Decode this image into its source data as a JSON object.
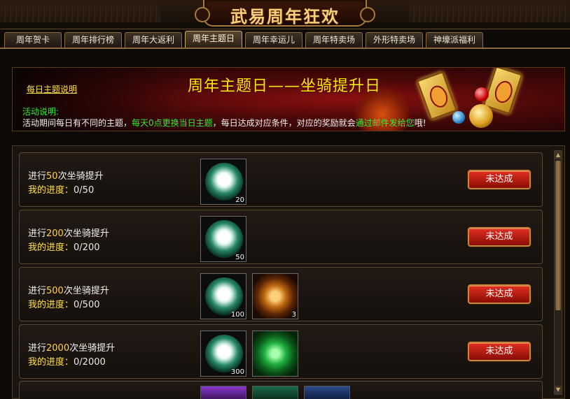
{
  "window": {
    "title": "武易周年狂欢"
  },
  "tabs": [
    {
      "label": "周年贺卡",
      "active": false
    },
    {
      "label": "周年排行榜",
      "active": false
    },
    {
      "label": "周年大返利",
      "active": false
    },
    {
      "label": "周年主题日",
      "active": true
    },
    {
      "label": "周年幸运儿",
      "active": false
    },
    {
      "label": "周年特卖场",
      "active": false
    },
    {
      "label": "外形特卖场",
      "active": false
    },
    {
      "label": "神壕派福利",
      "active": false
    }
  ],
  "banner": {
    "title": "周年主题日——坐骑提升日",
    "help_link": "每日主题说明",
    "desc_label": "活动说明:",
    "desc_part1": "活动期间每日有不同的主题，",
    "desc_part2": "每天0点更换当日主题",
    "desc_part3": "，每日达成对应条件，对应的奖励就会",
    "desc_part4": "通过邮件发给您",
    "desc_part5": "哦!"
  },
  "tasks": [
    {
      "prefix": "进行",
      "count": "50",
      "suffix": "次坐骑提升",
      "progress_label": "我的进度：",
      "progress": "0/50",
      "rewards": [
        {
          "icon": "saddle-icon",
          "qty": "20"
        }
      ],
      "status": "未达成"
    },
    {
      "prefix": "进行",
      "count": "200",
      "suffix": "次坐骑提升",
      "progress_label": "我的进度：",
      "progress": "0/200",
      "rewards": [
        {
          "icon": "saddle-icon",
          "qty": "50"
        }
      ],
      "status": "未达成"
    },
    {
      "prefix": "进行",
      "count": "500",
      "suffix": "次坐骑提升",
      "progress_label": "我的进度：",
      "progress": "0/500",
      "rewards": [
        {
          "icon": "saddle-icon",
          "qty": "100"
        },
        {
          "icon": "stone-icon",
          "qty": "3"
        }
      ],
      "status": "未达成"
    },
    {
      "prefix": "进行",
      "count": "2000",
      "suffix": "次坐骑提升",
      "progress_label": "我的进度：",
      "progress": "0/2000",
      "rewards": [
        {
          "icon": "saddle-icon",
          "qty": "300"
        },
        {
          "icon": "gift-box-icon",
          "qty": ""
        }
      ],
      "status": "未达成"
    }
  ],
  "colors": {
    "accent": "#ffe800",
    "highlight": "#34e834",
    "button": "#c81e14"
  }
}
